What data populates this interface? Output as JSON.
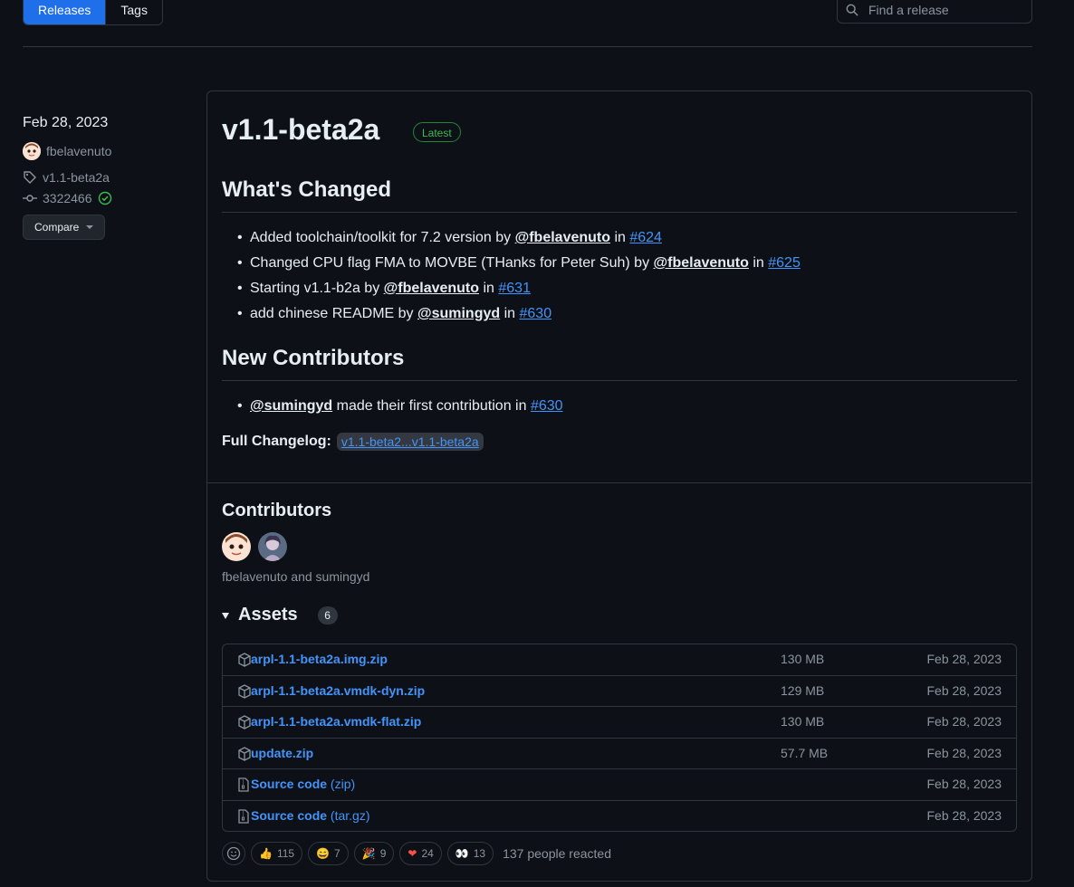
{
  "tabs": [
    {
      "label": "Releases"
    },
    {
      "label": "Tags"
    }
  ],
  "search": {
    "placeholder": "Find a release"
  },
  "sidebar": {
    "date": "Feb 28, 2023",
    "author": "fbelavenuto",
    "tag": "v1.1-beta2a",
    "commit": "3322466",
    "compare_label": "Compare"
  },
  "release": {
    "title": "v1.1-beta2a",
    "badge": "Latest",
    "whats_changed": "What's Changed",
    "changes": [
      {
        "pre": "Added toolchain/toolkit for 7.2 version by ",
        "user": "@fbelavenuto",
        "mid": " in ",
        "pr": "#624"
      },
      {
        "pre": "Changed CPU flag FMA to MOVBE (THanks for Peter Suh) by ",
        "user": "@fbelavenuto",
        "mid": " in ",
        "pr": "#625"
      },
      {
        "pre": "Starting v1.1-b2a by ",
        "user": "@fbelavenuto",
        "mid": " in ",
        "pr": "#631"
      },
      {
        "pre": "add chinese README by ",
        "user": "@sumingyd",
        "mid": " in ",
        "pr": "#630"
      }
    ],
    "new_contributors": "New Contributors",
    "new_contrib": {
      "user": "@sumingyd",
      "mid": " made their first contribution in ",
      "pr": "#630"
    },
    "full_changelog_label": "Full Changelog:",
    "full_changelog_link": "v1.1-beta2...v1.1-beta2a",
    "contributors_title": "Contributors",
    "contributors_names": "fbelavenuto and sumingyd",
    "assets_title": "Assets",
    "assets_count": "6",
    "assets": [
      {
        "name": "arpl-1.1-beta2a.img.zip",
        "suffix": "",
        "size": "130 MB",
        "date": "Feb 28, 2023",
        "icon": "package-icon"
      },
      {
        "name": "arpl-1.1-beta2a.vmdk-dyn.zip",
        "suffix": "",
        "size": "129 MB",
        "date": "Feb 28, 2023",
        "icon": "package-icon"
      },
      {
        "name": "arpl-1.1-beta2a.vmdk-flat.zip",
        "suffix": "",
        "size": "130 MB",
        "date": "Feb 28, 2023",
        "icon": "package-icon"
      },
      {
        "name": "update.zip",
        "suffix": "",
        "size": "57.7 MB",
        "date": "Feb 28, 2023",
        "icon": "package-icon"
      },
      {
        "name": "Source code",
        "suffix": " (zip)",
        "size": "",
        "date": "Feb 28, 2023",
        "icon": "file-zip-icon"
      },
      {
        "name": "Source code",
        "suffix": " (tar.gz)",
        "size": "",
        "date": "Feb 28, 2023",
        "icon": "file-zip-icon"
      }
    ],
    "reactions": [
      {
        "emoji": "👍",
        "count": "115",
        "icon": "thumbs-up-icon"
      },
      {
        "emoji": "😄",
        "count": "7",
        "icon": "laugh-icon"
      },
      {
        "emoji": "🎉",
        "count": "9",
        "icon": "hooray-icon"
      },
      {
        "emoji": "❤",
        "count": "24",
        "icon": "heart-icon"
      },
      {
        "emoji": "👀",
        "count": "13",
        "icon": "eyes-icon"
      }
    ],
    "reacted_text": "137 people reacted"
  },
  "colors": {
    "accent": "#4493f8",
    "primary": "#1f6feb",
    "latest": "#3fb950",
    "bg": "#0d1117"
  }
}
